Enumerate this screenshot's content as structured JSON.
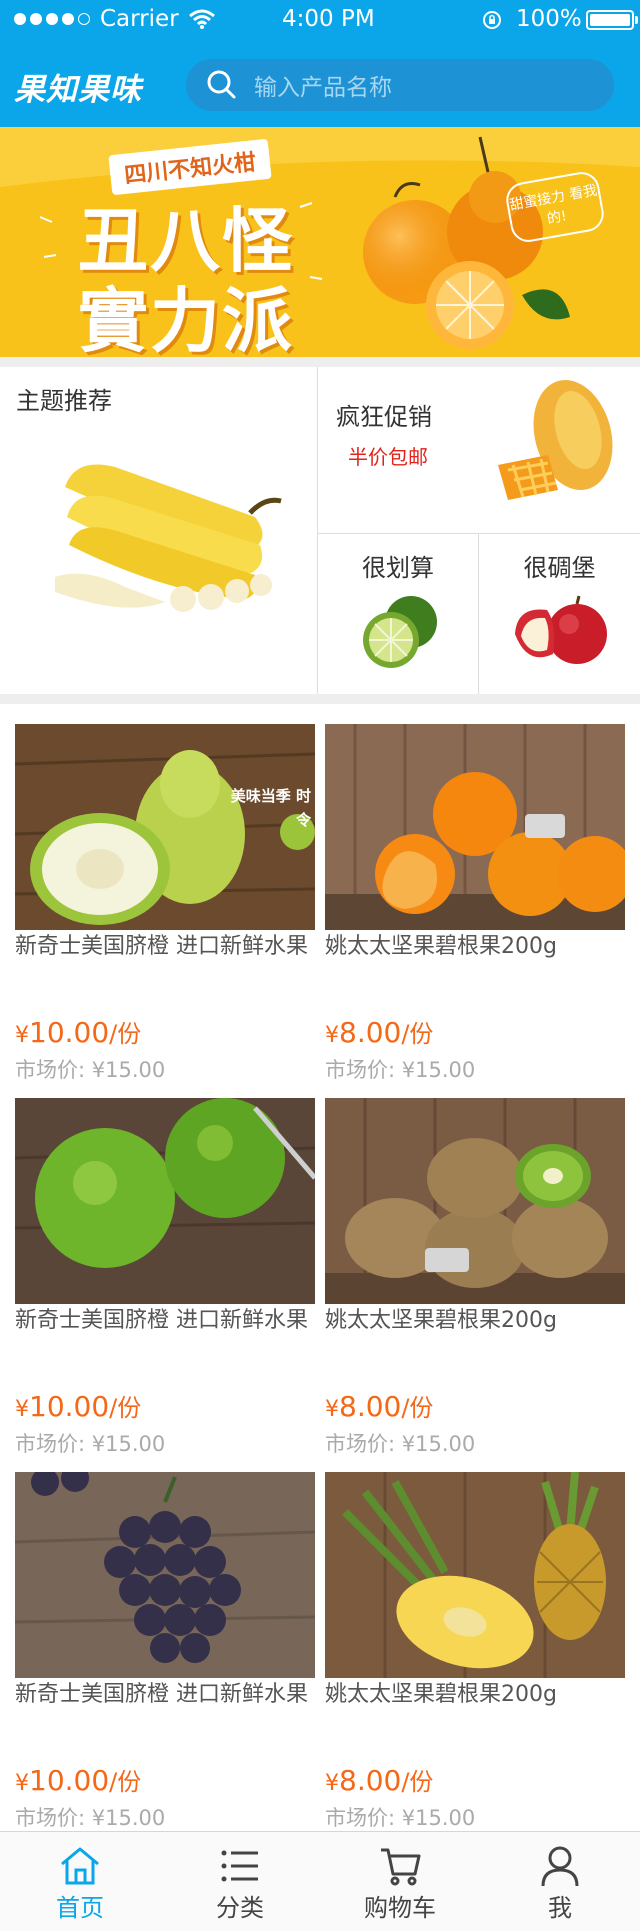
{
  "status_bar": {
    "carrier": "Carrier",
    "time": "4:00 PM",
    "battery": "100%"
  },
  "header": {
    "logo": "果知果味",
    "search_placeholder": "输入产品名称"
  },
  "banner": {
    "top_tag": "四川不知火柑",
    "line1": "丑八怪",
    "line2": "實力派",
    "bubble": "甜蜜接力 看我的!"
  },
  "promo": {
    "theme_title": "主题推荐",
    "sale_title": "疯狂促销",
    "sale_sub": "半价包邮",
    "cheap_title": "很划算",
    "tasty_title": "很碉堡"
  },
  "products": [
    {
      "name": "新奇士美国脐橙 进口新鲜水果",
      "currency": "¥",
      "price": "10.00",
      "unit": "/份",
      "market": "市场价: ¥15.00",
      "fruit": "guava",
      "overlay": "美味当季 时令"
    },
    {
      "name": "姚太太坚果碧根果200g",
      "currency": "¥",
      "price": "8.00",
      "unit": "/份",
      "market": "市场价: ¥15.00",
      "fruit": "orange",
      "overlay": ""
    },
    {
      "name": "新奇士美国脐橙 进口新鲜水果",
      "currency": "¥",
      "price": "10.00",
      "unit": "/份",
      "market": "市场价: ¥15.00",
      "fruit": "green-apple",
      "overlay": ""
    },
    {
      "name": "姚太太坚果碧根果200g",
      "currency": "¥",
      "price": "8.00",
      "unit": "/份",
      "market": "市场价: ¥15.00",
      "fruit": "kiwi",
      "overlay": ""
    },
    {
      "name": "新奇士美国脐橙 进口新鲜水果",
      "currency": "¥",
      "price": "10.00",
      "unit": "/份",
      "market": "市场价: ¥15.00",
      "fruit": "grape",
      "overlay": ""
    },
    {
      "name": "姚太太坚果碧根果200g",
      "currency": "¥",
      "price": "8.00",
      "unit": "/份",
      "market": "市场价: ¥15.00",
      "fruit": "pineapple",
      "overlay": ""
    }
  ],
  "tabbar": [
    {
      "label": "首页",
      "icon": "home-icon",
      "active": true
    },
    {
      "label": "分类",
      "icon": "list-icon",
      "active": false
    },
    {
      "label": "购物车",
      "icon": "cart-icon",
      "active": false
    },
    {
      "label": "我",
      "icon": "user-icon",
      "active": false
    }
  ],
  "colors": {
    "brand": "#0ba6e9",
    "price": "#f46818",
    "sale_red": "#e0231b",
    "banner_yellow": "#f9c21a"
  }
}
